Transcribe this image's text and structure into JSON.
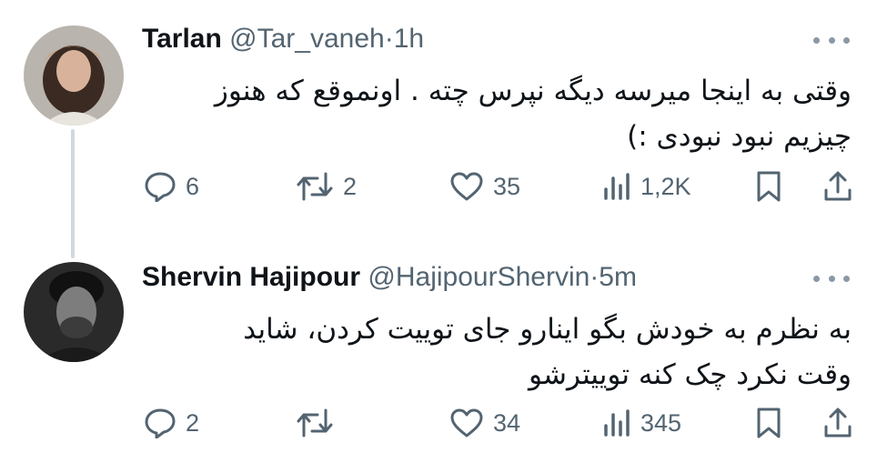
{
  "tweets": [
    {
      "name": "Tarlan",
      "handle": "@Tar_vaneh",
      "separator": "·",
      "time": "1h",
      "text_lines": [
        "وقتی به اینجا میرسه دیگه نپرس چته . اونموقع که هنوز",
        "چیزیم نبود نبودی :)"
      ],
      "replies": "6",
      "retweets": "2",
      "likes": "35",
      "views": "1,2K"
    },
    {
      "name": "Shervin Hajipour",
      "handle": "@HajipourShervin",
      "separator": "·",
      "time": "5m",
      "text_lines": [
        "به نظرم به خودش بگو اینارو جای توییت کردن، شاید",
        "وقت نکرد چک کنه توییترشو"
      ],
      "replies": "2",
      "retweets": "",
      "likes": "34",
      "views": "345"
    }
  ],
  "colors": {
    "text": "#0f1419",
    "secondary": "#536471",
    "thread_line": "#cfd9de"
  },
  "icons": [
    "reply-icon",
    "retweet-icon",
    "like-icon",
    "views-icon",
    "bookmark-icon",
    "share-icon",
    "more-icon"
  ]
}
